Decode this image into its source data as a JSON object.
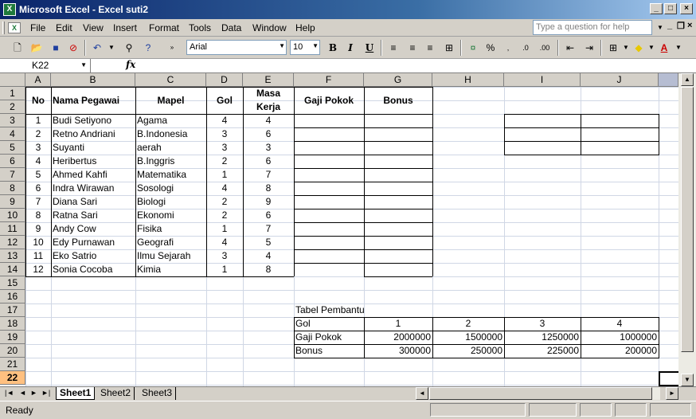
{
  "window": {
    "title": "Microsoft Excel - Excel suti2",
    "app_icon": "X"
  },
  "menu": [
    "File",
    "Edit",
    "View",
    "Insert",
    "Format",
    "Tools",
    "Data",
    "Window",
    "Help"
  ],
  "help_placeholder": "Type a question for help",
  "font": {
    "name": "Arial",
    "size": "10"
  },
  "namebox": "K22",
  "fx_label": "fx",
  "columns": [
    "A",
    "B",
    "C",
    "D",
    "E",
    "F",
    "G",
    "H",
    "I",
    "J"
  ],
  "rows": [
    "1",
    "2",
    "3",
    "4",
    "5",
    "6",
    "7",
    "8",
    "9",
    "10",
    "11",
    "12",
    "13",
    "14",
    "15",
    "16",
    "17",
    "18",
    "19",
    "20",
    "21",
    "22"
  ],
  "headers": {
    "no": "No",
    "nama": "Nama Pegawai",
    "mapel": "Mapel",
    "gol": "Gol",
    "masa1": "Masa",
    "masa2": "Kerja",
    "gaji": "Gaji Pokok",
    "bonus": "Bonus"
  },
  "employees": [
    [
      "1",
      "Budi Setiyono",
      "Agama",
      "4",
      "4"
    ],
    [
      "2",
      "Retno Andriani",
      "B.Indonesia",
      "3",
      "6"
    ],
    [
      "3",
      "Suyanti",
      "aerah",
      "3",
      "3"
    ],
    [
      "4",
      "Heribertus",
      "B.Inggris",
      "2",
      "6"
    ],
    [
      "5",
      "Ahmed Kahfi",
      "Matematika",
      "1",
      "7"
    ],
    [
      "6",
      "Indra Wirawan",
      "Sosologi",
      "4",
      "8"
    ],
    [
      "7",
      "Diana Sari",
      "Biologi",
      "2",
      "9"
    ],
    [
      "8",
      "Ratna Sari",
      "Ekonomi",
      "2",
      "6"
    ],
    [
      "9",
      "Andy Cow",
      "Fisika",
      "1",
      "7"
    ],
    [
      "10",
      "Edy Purnawan",
      "Geografi",
      "4",
      "5"
    ],
    [
      "11",
      "Eko Satrio",
      "Ilmu Sejarah",
      "3",
      "4"
    ],
    [
      "12",
      "Sonia Cocoba",
      "Kimia",
      "1",
      "8"
    ]
  ],
  "helper": {
    "title": "Tabel Pembantu",
    "rows": [
      [
        "Gol",
        "1",
        "2",
        "3",
        "4"
      ],
      [
        "Gaji Pokok",
        "2000000",
        "1500000",
        "1250000",
        "1000000"
      ],
      [
        "Bonus",
        "300000",
        "250000",
        "225000",
        "200000"
      ]
    ]
  },
  "sheets": [
    "Sheet1",
    "Sheet2",
    "Sheet3"
  ],
  "status": "Ready"
}
